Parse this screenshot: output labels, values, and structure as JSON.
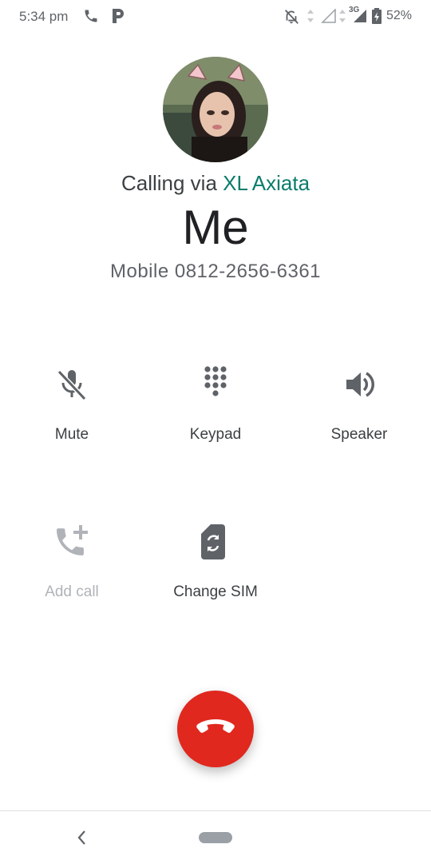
{
  "status_bar": {
    "time": "5:34 pm",
    "network": "3G",
    "battery": "52%",
    "icons": [
      "phone-icon",
      "p-app-icon",
      "notifications-off-icon",
      "data-arrows-icon",
      "signal-empty-icon",
      "signal-3g-icon",
      "battery-charging-icon"
    ]
  },
  "call": {
    "calling_prefix": "Calling via",
    "carrier": "XL Axiata",
    "name": "Me",
    "number_line": "Mobile 0812-2656-6361"
  },
  "controls": {
    "mute": "Mute",
    "keypad": "Keypad",
    "speaker": "Speaker",
    "add_call": "Add call",
    "change_sim": "Change SIM"
  },
  "colors": {
    "accent": "#0b7c6b",
    "end_call": "#e0281e",
    "icon": "#5f6368",
    "disabled": "#b0b3b8"
  }
}
